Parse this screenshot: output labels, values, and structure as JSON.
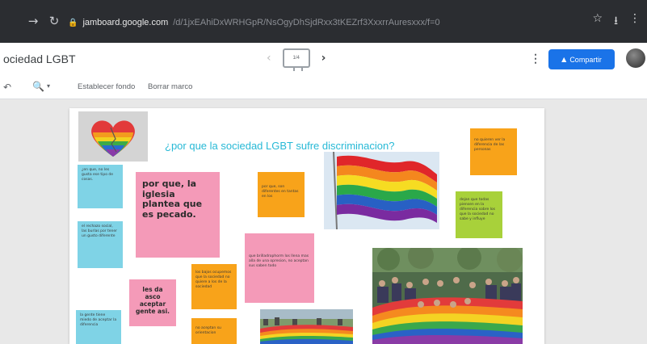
{
  "browser": {
    "url_host": "jamboard.google.com",
    "url_path": "/d/1jxEAhiDxWRHGpR/NsOgyDhSjdRxx3tKEZrf3XxxrrAuresxxx/f=0"
  },
  "header": {
    "doc_title": "ociedad LGBT",
    "frame_label": "1/4",
    "share_label": "Compartir"
  },
  "toolbar": {
    "set_background": "Establecer fondo",
    "clear_frame": "Borrar marco"
  },
  "board": {
    "question": "¿por que la sociedad LGBT sufre discriminacion?",
    "notes": [
      {
        "color": "blue",
        "text": "¿en que, no les gusta ese tipo de cosas."
      },
      {
        "color": "blue",
        "text": "el rechazo social, las burlas por tener un gusto diferente"
      },
      {
        "color": "blue",
        "text": "la gente tiene miedo de aceptar la diferencia"
      },
      {
        "color": "pink",
        "text": "por que, la iglesia plantea que es pecado."
      },
      {
        "color": "pink",
        "text": "les da asco aceptar gente asi."
      },
      {
        "color": "pink",
        "text": "que brilladrophorm los llena mas alla de una opresion, no aceptan sus saben todo"
      },
      {
        "color": "orange",
        "text": "por que, son diferentes en tantas en los"
      },
      {
        "color": "orange",
        "text": "los bajos ocupemos que la sociedad no quiere a los de la sociedad"
      },
      {
        "color": "orange",
        "text": "no aceptan su orientacion"
      },
      {
        "color": "orange",
        "text": "no quieren ver la diferencia de las personas"
      },
      {
        "color": "green",
        "text": "dejan que todas piensen en la diferencia sobre los que la sociedad no sabe y influye"
      }
    ]
  },
  "icons": {
    "back": "arrow-right-icon",
    "reload": "reload-icon",
    "lock": "lock-icon",
    "star": "star-icon",
    "download": "download-icon",
    "menu": "more-vert-icon",
    "zoom": "zoom-icon",
    "prev": "chevron-left-icon",
    "next": "chevron-right-icon"
  },
  "colors": {
    "share_button": "#1a73e8",
    "note_blue": "#7fd3e6",
    "note_pink": "#f49ab8",
    "note_orange": "#f8a31a",
    "note_green": "#a8d13a",
    "question_text": "#27b9d6"
  }
}
